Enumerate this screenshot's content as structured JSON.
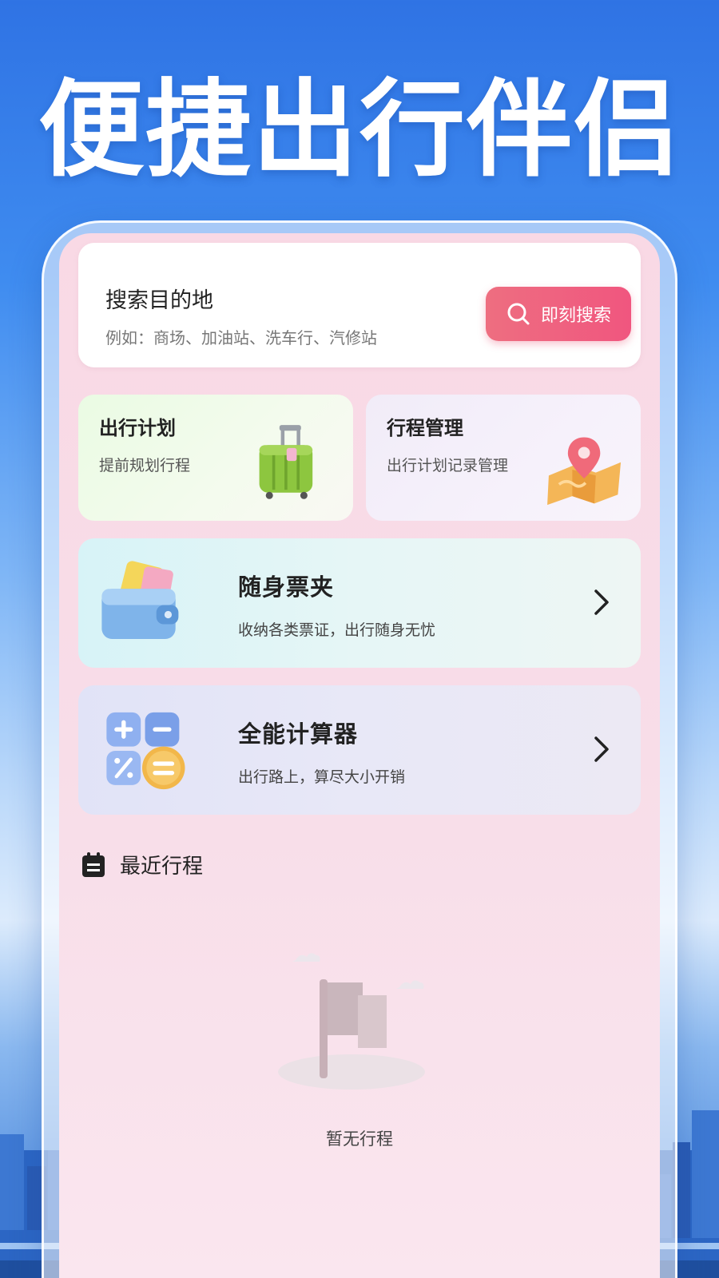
{
  "headline": "便捷出行伴侣",
  "search": {
    "title": "搜索目的地",
    "hint": "例如：商场、加油站、洗车行、汽修站",
    "button_label": "即刻搜索"
  },
  "cards": {
    "plan": {
      "title": "出行计划",
      "subtitle": "提前规划行程",
      "icon": "suitcase-icon"
    },
    "trip": {
      "title": "行程管理",
      "subtitle": "出行计划记录管理",
      "icon": "map-pin-icon"
    },
    "wallet": {
      "title": "随身票夹",
      "subtitle": "收纳各类票证，出行随身无忧",
      "icon": "wallet-icon"
    },
    "calculator": {
      "title": "全能计算器",
      "subtitle": "出行路上，算尽大小开销",
      "icon": "calculator-icon"
    }
  },
  "recent": {
    "title": "最近行程",
    "empty_text": "暂无行程"
  },
  "colors": {
    "accent": "#f0567f",
    "background_blue": "#3f8cf0",
    "screen_pink": "#f9d9e5"
  }
}
